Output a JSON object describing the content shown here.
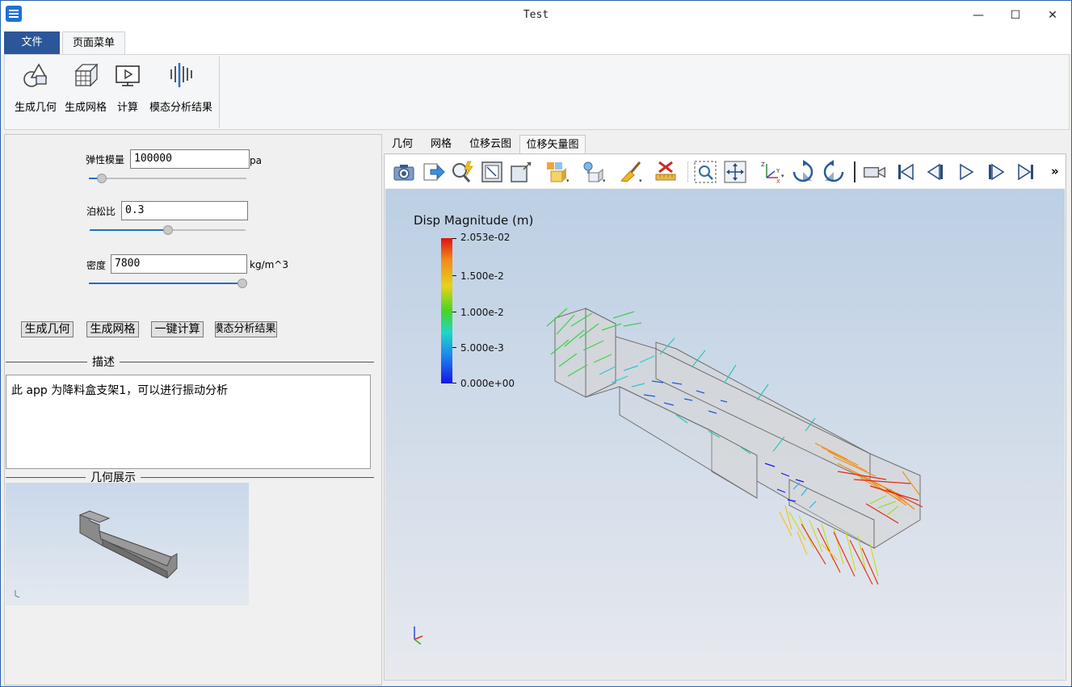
{
  "window": {
    "title": "Test",
    "minimize_glyph": "—",
    "maximize_glyph": "☐",
    "close_glyph": "✕"
  },
  "ribbon": {
    "tabs": [
      "文件",
      "页面菜单"
    ],
    "buttons": [
      {
        "label": "生成几何",
        "icon": "geometry-shapes-icon"
      },
      {
        "label": "生成网格",
        "icon": "mesh-cube-icon"
      },
      {
        "label": "计算",
        "icon": "compute-monitor-icon"
      },
      {
        "label": "模态分析结果",
        "icon": "modal-result-icon"
      }
    ]
  },
  "params": {
    "elastic_label": "弹性模量",
    "elastic_value": "100000",
    "elastic_unit": "pa",
    "elastic_slider": 0.08,
    "poisson_label": "泊松比",
    "poisson_value": "0.3",
    "poisson_slider": 0.5,
    "density_label": "密度",
    "density_value": "7800",
    "density_unit": "kg/m^3",
    "density_slider": 1.0
  },
  "actions": {
    "geometry": "生成几何",
    "mesh": "生成网格",
    "compute": "一键计算",
    "modal": "模态分析结果"
  },
  "description": {
    "title": "描述",
    "text": "此 app 为降料盒支架1，可以进行振动分析"
  },
  "geometry_preview": {
    "title": "几何展示"
  },
  "view_tabs": [
    "几何",
    "网格",
    "位移云图",
    "位移矢量图"
  ],
  "active_view_tab": "位移矢量图",
  "toolbar": {
    "icons": [
      "camera-icon",
      "export-arrow-icon",
      "query-icon",
      "reset-view-icon",
      "zoom-box-icon",
      "color-cube-icon",
      "light-bulb-icon",
      "clear-brush-icon",
      "ruler-icon",
      "zoom-region-icon",
      "pan-icon",
      "axes-icon",
      "rotate-cw-icon",
      "rotate-ccw-icon",
      "video-camera-icon",
      "first-frame-icon",
      "prev-frame-icon",
      "play-icon",
      "next-frame-icon",
      "last-frame-icon"
    ],
    "overflow": "»"
  },
  "colorbar": {
    "title": "Disp Magnitude (m)",
    "labels": [
      "2.053e-02",
      "1.500e-2",
      "1.000e-2",
      "5.000e-3",
      "0.000e+00"
    ],
    "colors": [
      "#e01010",
      "#f28a1a",
      "#e7d21b",
      "#46d622",
      "#1fd7c6",
      "#1b7ff0",
      "#1515e8"
    ]
  },
  "colors": {
    "accent": "#2b579a",
    "slider_fill": "#1f6fc4",
    "viewport_top": "#bccfe4",
    "viewport_bottom": "#e7e9ee"
  }
}
